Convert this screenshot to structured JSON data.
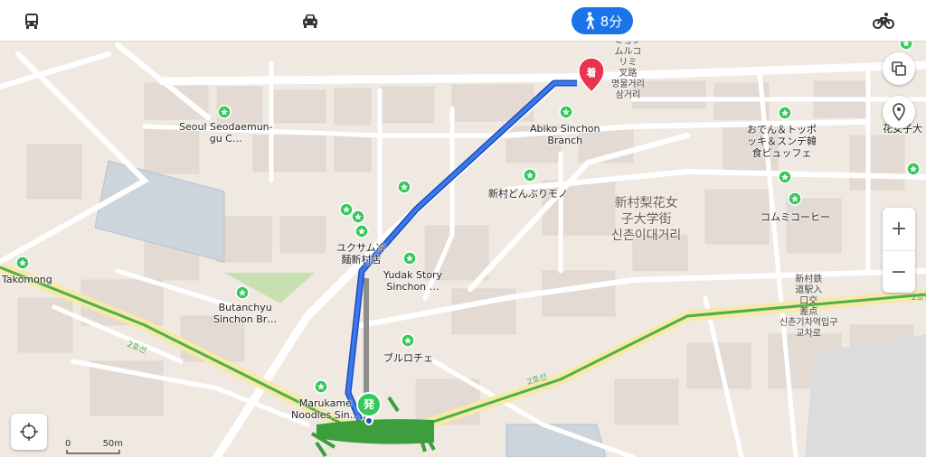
{
  "modes": {
    "transit_icon": "bus-icon",
    "car_icon": "car-icon",
    "walk_icon": "walk-icon",
    "walk_time": "8分",
    "bike_icon": "bicycle-icon"
  },
  "colors": {
    "accent": "#1a73e8",
    "route": "#2f6fe0",
    "rail": "#4caf50",
    "poi": "#34c759",
    "dest_pin": "#e8344e"
  },
  "markers": {
    "start": "発",
    "destination": "着"
  },
  "pois": [
    "Seoul Seodaemun-\ngu C…",
    "Abiko Sinchon\nBranch",
    "おでん＆トッポ\nッキ＆スンデ韓\n食ビュッフェ",
    "新村どんぶりモノ",
    "コムミコーヒー",
    "ユクサム冷\n麺新村店",
    "Yudak Story\nSinchon …",
    "Takomong",
    "Butanchyu\nSinchon Br…",
    "ブルロチェ",
    "Marukame\nNoodles Sin…",
    "花女子大"
  ],
  "labels": {
    "area": "新村梨花女\n子大学街\n신촌이대거리",
    "street": "ミョン\nムルコ\nリミ\n叉路\n명물거리\n삼거리",
    "station": "新村鉄\n道駅入\n口交\n差点\n신촌기차역입구\n교차로",
    "line_left": "2호선",
    "line_mid": "2호선",
    "line_right": "2호선"
  },
  "controls": {
    "zoom_in": "+",
    "zoom_out": "−",
    "layers_icon": "layers-icon",
    "pin_icon": "location-pin-icon",
    "locate_icon": "crosshair-icon"
  },
  "scale": {
    "zero": "0",
    "distance": "50m"
  }
}
